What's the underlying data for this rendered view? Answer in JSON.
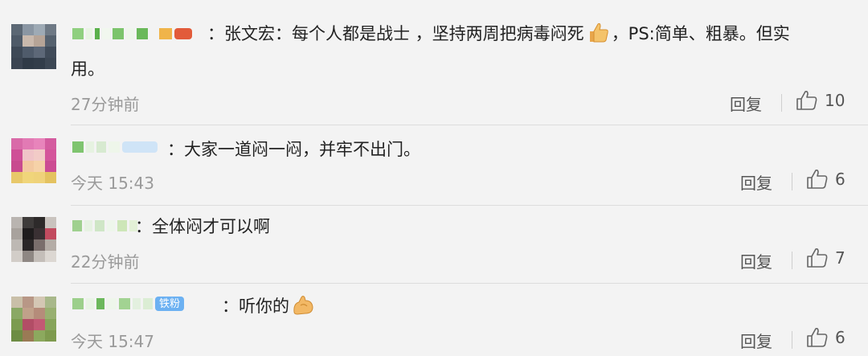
{
  "comments": [
    {
      "badge": "",
      "content_prefix": "：张文宏：每个人都是战士 ，坚持两周把病毒闷死",
      "content_suffix": "，PS:简单、粗暴。但实",
      "content_wrap": "用。",
      "emoji": "thumbs-up-emoji",
      "time": "27分钟前",
      "reply_label": "回复",
      "like_count": "10"
    },
    {
      "badge": "",
      "content": "：大家一道闷一闷，并牢不出门。",
      "time": "今天 15:43",
      "reply_label": "回复",
      "like_count": "6"
    },
    {
      "badge": "",
      "content": "：全体闷才可以啊",
      "time": "22分钟前",
      "reply_label": "回复",
      "like_count": "7"
    },
    {
      "badge": "铁粉",
      "content": "：听你的",
      "emoji": "flexed-biceps-emoji",
      "time": "今天 15:47",
      "reply_label": "回复",
      "like_count": "6"
    }
  ],
  "icons": {
    "like": "thumbs-up-outline-icon"
  },
  "colors": {
    "background": "#f3f3f3",
    "time": "#9a9a9a",
    "badge": "#6cb1f2"
  }
}
